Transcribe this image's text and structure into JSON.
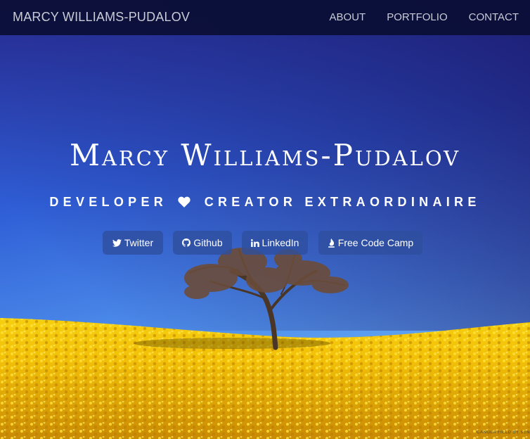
{
  "navbar": {
    "brand": "MARCY WILLIAMS-PUDALOV",
    "links": [
      {
        "label": "ABOUT"
      },
      {
        "label": "PORTFOLIO"
      },
      {
        "label": "CONTACT"
      }
    ]
  },
  "hero": {
    "title": "Marcy Williams-Pudalov",
    "subtitle_left": "DEVELOPER",
    "subtitle_right": "CREATOR EXTRAORDINAIRE",
    "heart_icon": "heart-icon"
  },
  "social": [
    {
      "label": "Twitter",
      "icon": "twitter-icon"
    },
    {
      "label": "Github",
      "icon": "github-icon"
    },
    {
      "label": "LinkedIn",
      "icon": "linkedin-icon"
    },
    {
      "label": "Free Code Camp",
      "icon": "fire-icon"
    }
  ],
  "photo_credit": "CANOLA FIELD BY SEN",
  "colors": {
    "navbar_bg": "#0a0e34",
    "nav_text": "#c9cbd6",
    "sky_top": "#1d1f78",
    "sky_bottom": "#5aa0ef",
    "field": "#f2c40a",
    "button_bg": "#2e4e9e"
  }
}
